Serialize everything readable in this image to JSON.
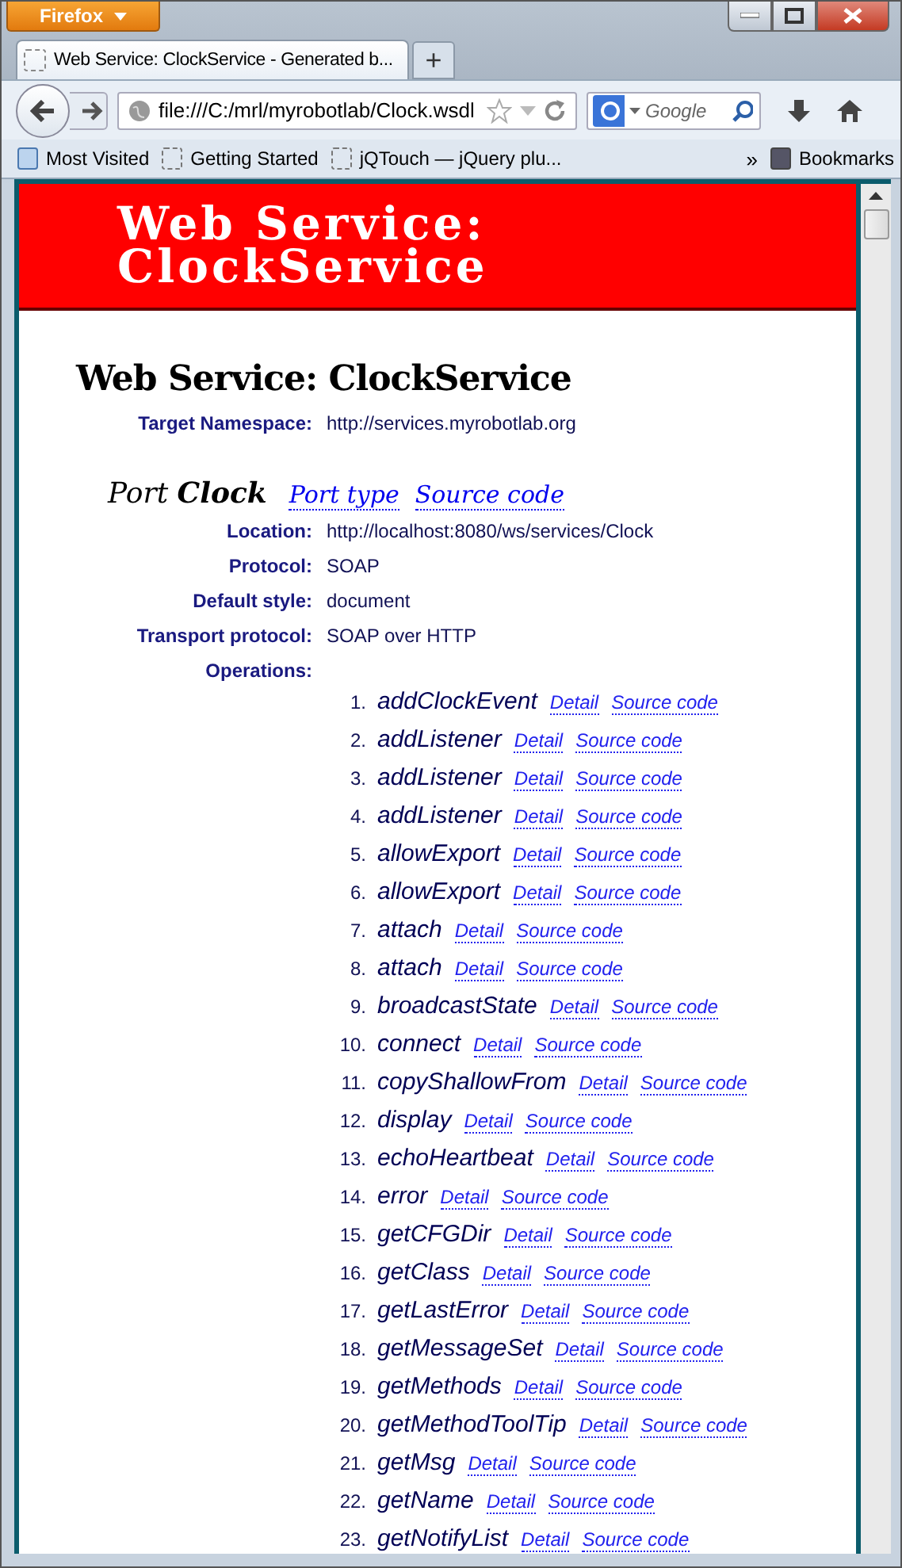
{
  "browser": {
    "menu_button": "Firefox",
    "tabs": [
      {
        "title": "Web Service: ClockService - Generated b...",
        "selected": true
      }
    ],
    "new_tab": "+",
    "address": "file:///C:/mrl/myrobotlab/Clock.wsdl",
    "search": {
      "placeholder": "Google"
    },
    "bookmarks": [
      "Most Visited",
      "Getting Started",
      "jQTouch — jQuery plu..."
    ],
    "overflow": "»",
    "bookmarks_menu": "Bookmarks"
  },
  "page": {
    "banner": "Web Service: ClockService",
    "heading": "Web Service: ClockService",
    "namespace": {
      "label": "Target Namespace:",
      "value": "http://services.myrobotlab.org"
    },
    "port": {
      "prefix": "Port",
      "name": "Clock",
      "links": [
        "Port type",
        "Source code"
      ]
    },
    "properties": [
      {
        "label": "Location:",
        "value": "http://localhost:8080/ws/services/Clock"
      },
      {
        "label": "Protocol:",
        "value": "SOAP"
      },
      {
        "label": "Default style:",
        "value": "document"
      },
      {
        "label": "Transport protocol:",
        "value": "SOAP over HTTP"
      }
    ],
    "operations_label": "Operations:",
    "operations": [
      {
        "number": "1.",
        "name": "addClockEvent",
        "links": [
          "Detail",
          "Source code"
        ]
      },
      {
        "number": "2.",
        "name": "addListener",
        "links": [
          "Detail",
          "Source code"
        ]
      },
      {
        "number": "3.",
        "name": "addListener",
        "links": [
          "Detail",
          "Source code"
        ]
      },
      {
        "number": "4.",
        "name": "addListener",
        "links": [
          "Detail",
          "Source code"
        ]
      },
      {
        "number": "5.",
        "name": "allowExport",
        "links": [
          "Detail",
          "Source code"
        ]
      },
      {
        "number": "6.",
        "name": "allowExport",
        "links": [
          "Detail",
          "Source code"
        ]
      },
      {
        "number": "7.",
        "name": "attach",
        "links": [
          "Detail",
          "Source code"
        ]
      },
      {
        "number": "8.",
        "name": "attach",
        "links": [
          "Detail",
          "Source code"
        ]
      },
      {
        "number": "9.",
        "name": "broadcastState",
        "links": [
          "Detail",
          "Source code"
        ]
      },
      {
        "number": "10.",
        "name": "connect",
        "links": [
          "Detail",
          "Source code"
        ]
      },
      {
        "number": "11.",
        "name": "copyShallowFrom",
        "links": [
          "Detail",
          "Source code"
        ]
      },
      {
        "number": "12.",
        "name": "display",
        "links": [
          "Detail",
          "Source code"
        ]
      },
      {
        "number": "13.",
        "name": "echoHeartbeat",
        "links": [
          "Detail",
          "Source code"
        ]
      },
      {
        "number": "14.",
        "name": "error",
        "links": [
          "Detail",
          "Source code"
        ]
      },
      {
        "number": "15.",
        "name": "getCFGDir",
        "links": [
          "Detail",
          "Source code"
        ]
      },
      {
        "number": "16.",
        "name": "getClass",
        "links": [
          "Detail",
          "Source code"
        ]
      },
      {
        "number": "17.",
        "name": "getLastError",
        "links": [
          "Detail",
          "Source code"
        ]
      },
      {
        "number": "18.",
        "name": "getMessageSet",
        "links": [
          "Detail",
          "Source code"
        ]
      },
      {
        "number": "19.",
        "name": "getMethods",
        "links": [
          "Detail",
          "Source code"
        ]
      },
      {
        "number": "20.",
        "name": "getMethodToolTip",
        "links": [
          "Detail",
          "Source code"
        ]
      },
      {
        "number": "21.",
        "name": "getMsg",
        "links": [
          "Detail",
          "Source code"
        ]
      },
      {
        "number": "22.",
        "name": "getName",
        "links": [
          "Detail",
          "Source code"
        ]
      },
      {
        "number": "23.",
        "name": "getNotifyList",
        "links": [
          "Detail",
          "Source code"
        ]
      }
    ]
  }
}
